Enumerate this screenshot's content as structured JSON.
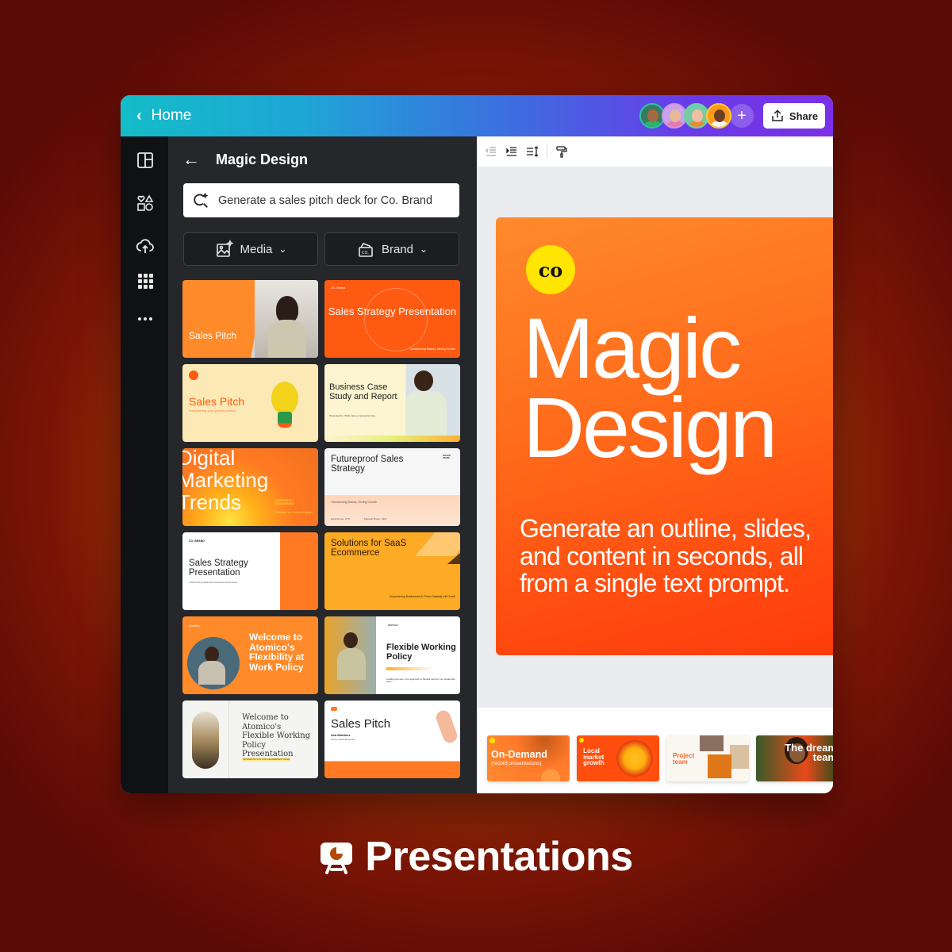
{
  "topbar": {
    "home_label": "Home",
    "share_label": "Share",
    "collaborators": [
      {
        "name": "collaborator-1",
        "ring": "#26c6a6",
        "bg": "#3a7a5c",
        "skin": "#a36a45",
        "shirt": "#2eb36a"
      },
      {
        "name": "collaborator-2",
        "ring": "#d08fe8",
        "bg": "#c9a3e8",
        "skin": "#e8b89a",
        "shirt": "#e47bb0"
      },
      {
        "name": "collaborator-3",
        "ring": "#63d6a0",
        "bg": "#78c9a6",
        "skin": "#f0c0a0",
        "shirt": "#e88a3a"
      },
      {
        "name": "collaborator-4",
        "ring": "#ffcc33",
        "bg": "#ff9a1a",
        "skin": "#6b3f24",
        "shirt": "#f5f5f5"
      }
    ],
    "add_label": "+"
  },
  "rail": {
    "items": [
      {
        "name": "rail-templates",
        "icon": "layout-icon"
      },
      {
        "name": "rail-elements",
        "icon": "elements-icon"
      },
      {
        "name": "rail-uploads",
        "icon": "cloud-upload-icon"
      },
      {
        "name": "rail-apps",
        "icon": "apps-grid-icon"
      },
      {
        "name": "rail-more",
        "icon": "more-icon"
      }
    ]
  },
  "panel": {
    "title": "Magic Design",
    "prompt_value": "Generate a sales pitch deck for Co. Brand",
    "filters": [
      {
        "label": "Media",
        "icon": "media-sparkle-icon"
      },
      {
        "label": "Brand",
        "icon": "brand-kit-icon"
      }
    ],
    "templates": [
      {
        "title": "Sales Pitch",
        "style": "orange-photo"
      },
      {
        "title": "Sales Strategy Presentation",
        "brand": "Co. Brand",
        "tagline": "Transforming Brands, Driving Growth",
        "style": "red-orange"
      },
      {
        "title": "Sales Pitch",
        "subtitle": "Empowering your growth journey",
        "style": "cream-bulb"
      },
      {
        "title": "Business Case Study and Report",
        "presented": "Presented by: Write name of presenter here",
        "style": "cream-photo"
      },
      {
        "title": "Digital Marketing Trends",
        "side": "OVERVIEW + DISCUSSION",
        "presenter": "Presented by Kimberly Nguyen",
        "style": "orange-gradient"
      },
      {
        "title": "Futureproof Sales Strategy",
        "tag": "SALES TEAM",
        "tagline": "Transforming Brands, Driving Growth",
        "p1": "Hannah Lee, CTO",
        "p2": "Maxwell Brown, CEO",
        "style": "white-peach"
      },
      {
        "title": "Sales Strategy Presentation",
        "brand": "CO. BRAND",
        "tagline": "Transforming Sales and Customer Experience",
        "style": "white-orange"
      },
      {
        "title": "Solutions for SaaS Ecommerce",
        "tagline": "Empowering Businesses to Thrive Digitally with SaaS",
        "style": "yellow"
      },
      {
        "title": "Welcome to Atomico's Flexibility at Work Policy",
        "brand": "Atomico",
        "style": "orange-circle"
      },
      {
        "title": "Flexible Working Policy",
        "brand": "Atomico",
        "tagline": "Leading the way: Our approach to flexible work for our leadership team",
        "style": "photo-white"
      },
      {
        "title": "Welcome to Atomico's Flexible Working Policy Presentation",
        "tag": "INTRODUCTION FOR LEADERSHIP TEAM",
        "style": "serif-white"
      },
      {
        "title": "Sales Pitch",
        "name": "Ava Martinez",
        "role": "Senior Sales Executive",
        "style": "white-orange-bar"
      }
    ]
  },
  "toolbar": {
    "icons": [
      "outdent-icon",
      "indent-icon",
      "line-spacing-icon",
      "paint-roller-icon"
    ]
  },
  "slide": {
    "logo": "co",
    "title_line1": "Magic",
    "title_line2": "Design",
    "subtitle": "Generate an outline, slides, and content in seconds, all from a single text prompt."
  },
  "filmstrip": [
    {
      "title": "On-Demand",
      "subtitle": "(record presentations)"
    },
    {
      "title": "Local market growth"
    },
    {
      "title": "Project team"
    },
    {
      "title": "The dream team"
    }
  ],
  "footer": {
    "label": "Presentations",
    "icon": "presentation-icon"
  },
  "colors": {
    "accent_orange": "#ff6a1a",
    "panel_bg": "#25272b",
    "rail_bg": "#0f1114",
    "logo_yellow": "#ffe500"
  }
}
